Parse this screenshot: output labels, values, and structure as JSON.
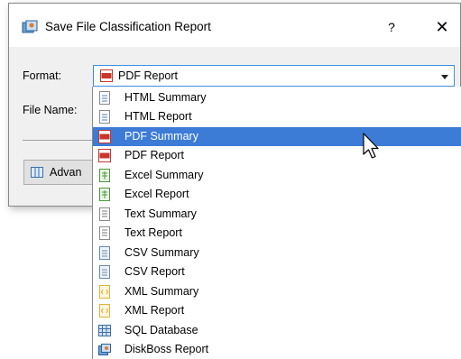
{
  "dialog": {
    "title": "Save File Classification Report",
    "help_label": "?",
    "close_label": "✕",
    "format_label": "Format:",
    "filename_label": "File Name:",
    "format_selected": "PDF Report",
    "advanced_label": "Advan"
  },
  "dropdown": {
    "items": [
      {
        "label": "HTML Summary",
        "icon": "html-doc-icon"
      },
      {
        "label": "HTML Report",
        "icon": "html-doc-icon"
      },
      {
        "label": "PDF Summary",
        "icon": "pdf-icon",
        "selected": true
      },
      {
        "label": "PDF Report",
        "icon": "pdf-icon"
      },
      {
        "label": "Excel Summary",
        "icon": "excel-icon"
      },
      {
        "label": "Excel Report",
        "icon": "excel-icon"
      },
      {
        "label": "Text Summary",
        "icon": "text-doc-icon"
      },
      {
        "label": "Text Report",
        "icon": "text-doc-icon"
      },
      {
        "label": "CSV Summary",
        "icon": "csv-icon"
      },
      {
        "label": "CSV Report",
        "icon": "csv-icon"
      },
      {
        "label": "XML Summary",
        "icon": "xml-icon"
      },
      {
        "label": "XML Report",
        "icon": "xml-icon"
      },
      {
        "label": "SQL Database",
        "icon": "database-grid-icon"
      },
      {
        "label": "DiskBoss Report",
        "icon": "diskboss-icon"
      }
    ]
  },
  "colors": {
    "selection": "#3c7bd6",
    "focus_border": "#3d8ee0",
    "pdf": "#c8362b",
    "excel": "#4a9a3a",
    "xml": "#e3b23c",
    "html": "#4a7fc0"
  }
}
